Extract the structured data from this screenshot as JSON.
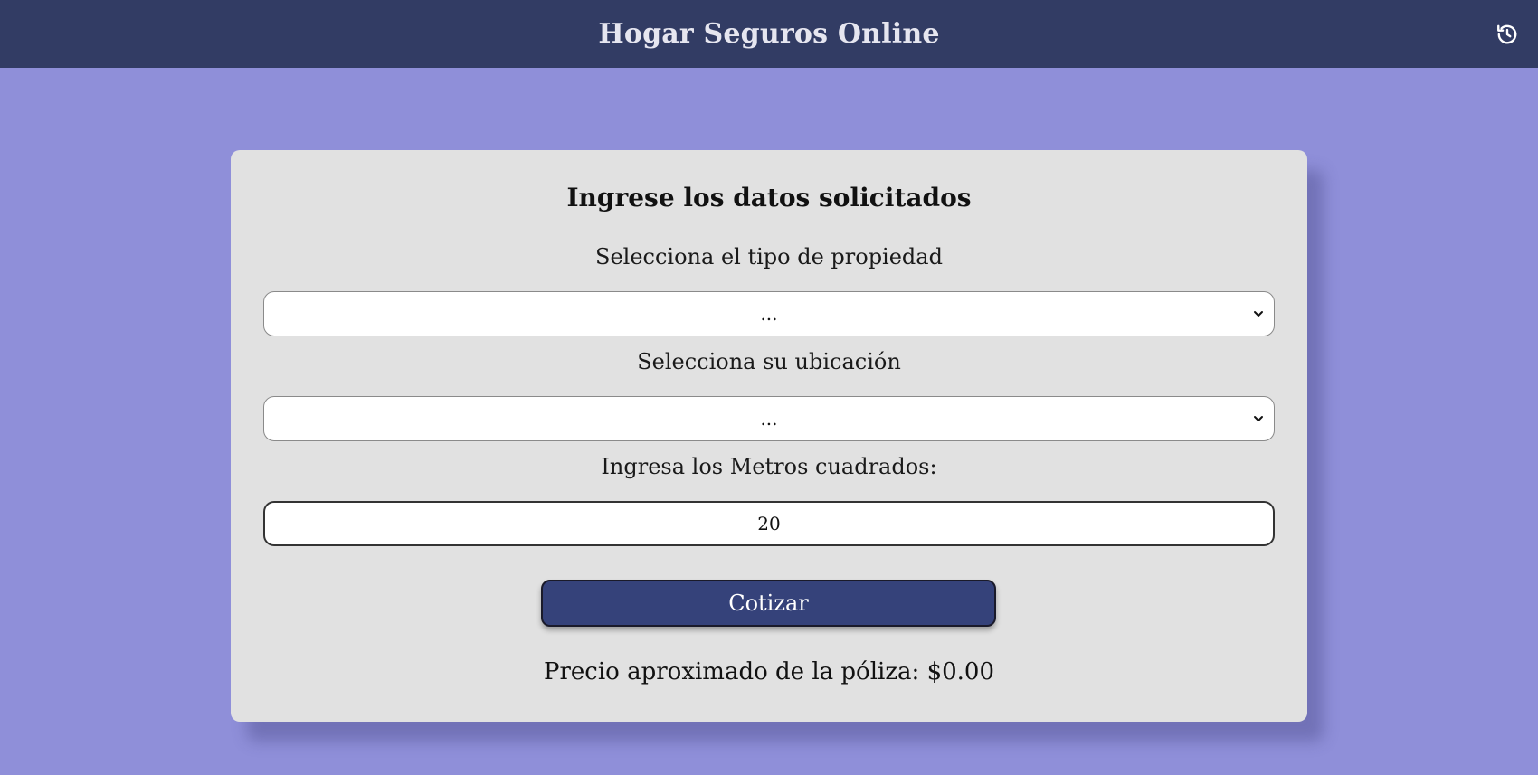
{
  "header": {
    "title": "Hogar Seguros Online",
    "history_icon": "history-icon"
  },
  "form": {
    "title": "Ingrese los datos solicitados",
    "property_label": "Selecciona el tipo de propiedad",
    "property_value": "...",
    "location_label": "Selecciona su ubicación",
    "location_value": "...",
    "area_label": "Ingresa los Metros cuadrados:",
    "area_value": "20",
    "submit_label": "Cotizar",
    "price_prefix": "Precio aproximado de la póliza: ",
    "price_value": "$0.00"
  },
  "colors": {
    "background": "#8f8fd9",
    "header": "#323c64",
    "card": "#e1e1e1",
    "button": "#35427a"
  }
}
